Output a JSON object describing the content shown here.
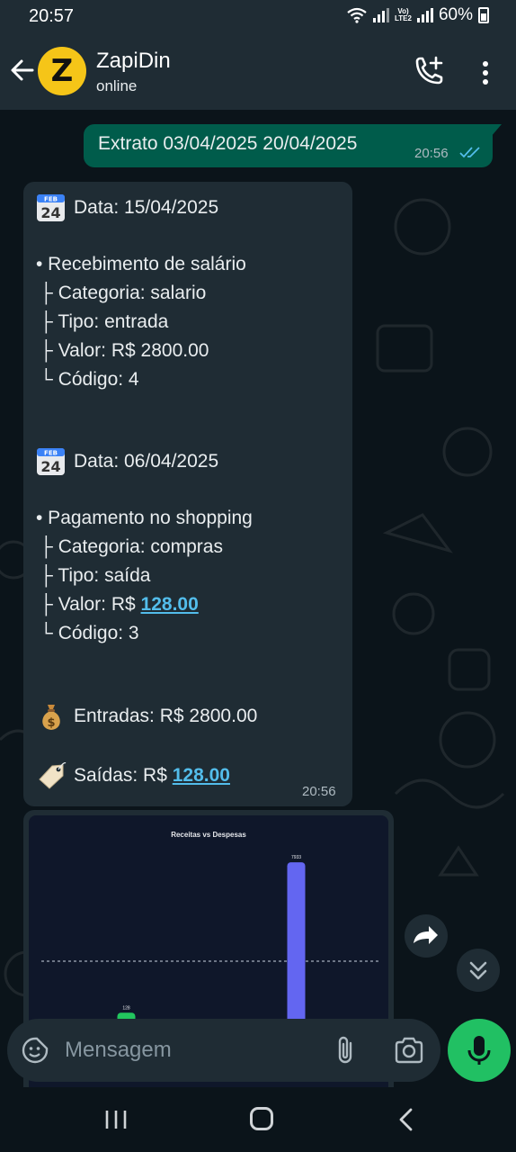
{
  "status_bar": {
    "time": "20:57",
    "battery": "60%",
    "volte_line1": "Vo)",
    "volte_line2": "LTE2"
  },
  "header": {
    "avatar_letter": "Z",
    "contact_name": "ZapiDin",
    "contact_status": "online"
  },
  "outgoing_message": {
    "text": "Extrato 03/04/2025 20/04/2025",
    "time": "20:56"
  },
  "incoming_message": {
    "entries": [
      {
        "date": "Data: 15/04/2025",
        "title": "• Recebimento de salário",
        "category": "├ Categoria: salario",
        "type": "├ Tipo: entrada",
        "value_prefix": "├ Valor: R$ ",
        "value": "2800.00",
        "code": "└ Código: 4"
      },
      {
        "date": "Data: 06/04/2025",
        "title": "• Pagamento no shopping",
        "category": "├ Categoria: compras",
        "type": "├ Tipo: saída",
        "value_prefix": "├ Valor: R$ ",
        "value": "128.00",
        "code": "└ Código: 3"
      }
    ],
    "calendar_month": "FEB",
    "calendar_day": "24",
    "totals": {
      "income": "Entradas: R$ 2800.00",
      "expense_prefix": "Saídas: R$ ",
      "expense_value": "128.00"
    },
    "time": "20:56"
  },
  "chart_data": {
    "type": "bar",
    "title": "Receitas vs Despesas",
    "categories": [
      "",
      ""
    ],
    "values": [
      128,
      7933
    ],
    "data_labels": [
      "128",
      "7933"
    ],
    "bar_colors": [
      "#22c55e",
      "#6366f1"
    ],
    "reference_line": {
      "style": "dashed",
      "value": 2800
    },
    "ylim": [
      0,
      8500
    ]
  },
  "composer": {
    "placeholder": "Mensagem"
  },
  "colors": {
    "header_bg": "#1f2c34",
    "chat_bg": "#0b141a",
    "outgoing_bubble": "#005c4b",
    "incoming_bubble": "#1f2c34",
    "link": "#53bdeb",
    "mic_button": "#21c063"
  },
  "icons": {
    "back": "arrow-left-icon",
    "call": "add-call-icon",
    "menu": "more-vert-icon",
    "calendar": "calendar-icon",
    "money_bag": "money-bag-icon",
    "label": "label-tag-icon",
    "forward": "forward-icon",
    "scroll_down": "double-chevron-down-icon",
    "emoji": "sticker-icon",
    "attach": "paperclip-icon",
    "camera": "camera-icon",
    "mic": "mic-icon"
  }
}
